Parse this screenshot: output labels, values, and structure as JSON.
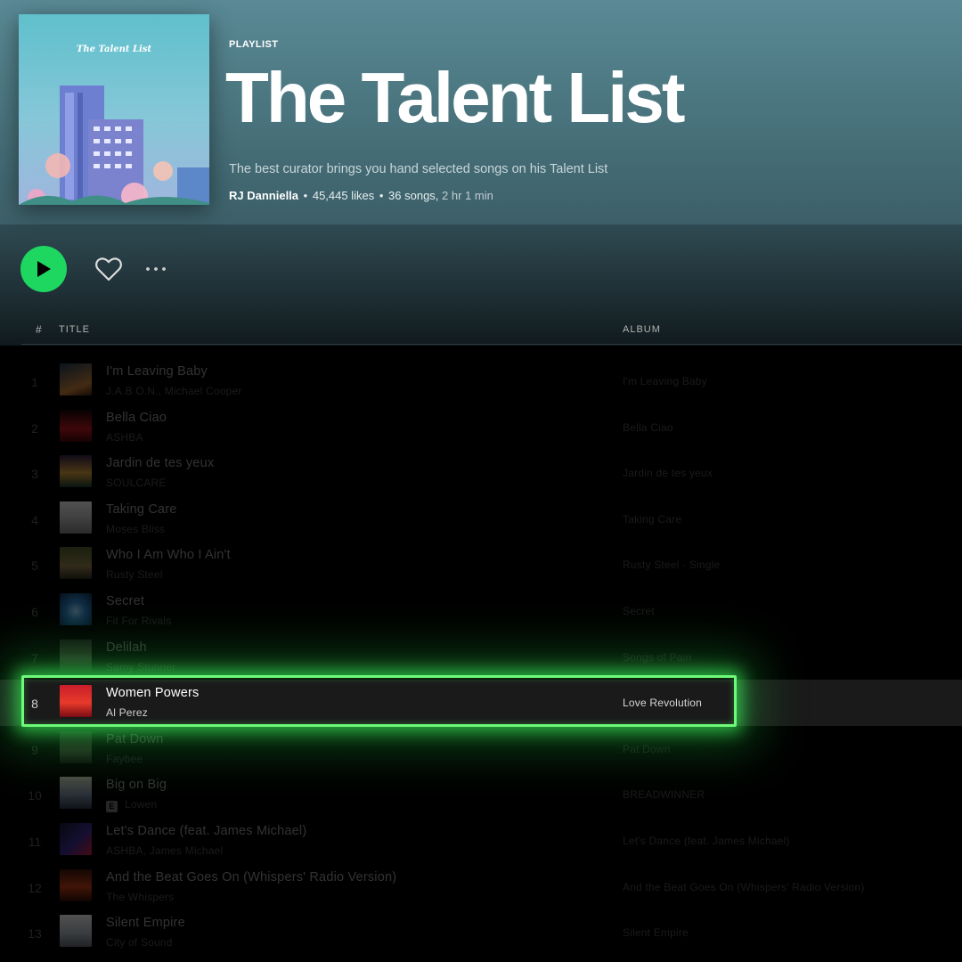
{
  "playlist": {
    "type_label": "PLAYLIST",
    "title": "The Talent List",
    "cover_title": "The Talent List",
    "description": "The best curator brings you hand selected songs on his Talent List",
    "owner": "RJ Danniella",
    "likes": "45,445 likes",
    "songs": "36 songs,",
    "duration": "2 hr 1 min",
    "separator": "•"
  },
  "controls": {
    "play_icon": "play-icon",
    "heart_icon": "heart-icon",
    "more_icon": "more-icon"
  },
  "columns": {
    "number": "#",
    "title": "TITLE",
    "album": "ALBUM"
  },
  "tracks": [
    {
      "num": "1",
      "title": "I'm Leaving Baby",
      "artist": "J.A.B.O.N., Michael Cooper",
      "album": "I'm Leaving Baby",
      "explicit": false
    },
    {
      "num": "2",
      "title": "Bella Ciao",
      "artist": "ASHBA",
      "album": "Bella Ciao",
      "explicit": false
    },
    {
      "num": "3",
      "title": "Jardin de tes yeux",
      "artist": "SOULCARE",
      "album": "Jardin de tes yeux",
      "explicit": false
    },
    {
      "num": "4",
      "title": "Taking Care",
      "artist": "Moses Bliss",
      "album": "Taking Care",
      "explicit": false
    },
    {
      "num": "5",
      "title": "Who I Am Who I Ain't",
      "artist": "Rusty Steel",
      "album": "Rusty Steel · Single",
      "explicit": false
    },
    {
      "num": "6",
      "title": "Secret",
      "artist": "Fit For Rivals",
      "album": "Secret",
      "explicit": false
    },
    {
      "num": "7",
      "title": "Delilah",
      "artist": "Samy Stunner",
      "album": "Songs of Pain",
      "explicit": false
    },
    {
      "num": "8",
      "title": "Women Powers",
      "artist": "Al Perez",
      "album": "Love Revolution",
      "explicit": false
    },
    {
      "num": "9",
      "title": "Pat Down",
      "artist": "Faybee",
      "album": "Pat Down",
      "explicit": false
    },
    {
      "num": "10",
      "title": "Big on Big",
      "artist": "Lowen",
      "album": "BREADWINNER",
      "explicit": true,
      "explicit_label": "E"
    },
    {
      "num": "11",
      "title": "Let's Dance (feat. James Michael)",
      "artist": "ASHBA, James Michael",
      "album": "Let's Dance (feat. James Michael)",
      "explicit": false
    },
    {
      "num": "12",
      "title": "And the Beat Goes On (Whispers' Radio Version)",
      "artist": "The Whispers",
      "album": "And the Beat Goes On (Whispers' Radio Version)",
      "explicit": false
    },
    {
      "num": "13",
      "title": "Silent Empire",
      "artist": "City of Sound",
      "album": "Silent Empire",
      "explicit": false
    }
  ],
  "highlighted_track": "8",
  "colors": {
    "accent": "#1ed760",
    "highlight_border": "#6dfa78"
  }
}
